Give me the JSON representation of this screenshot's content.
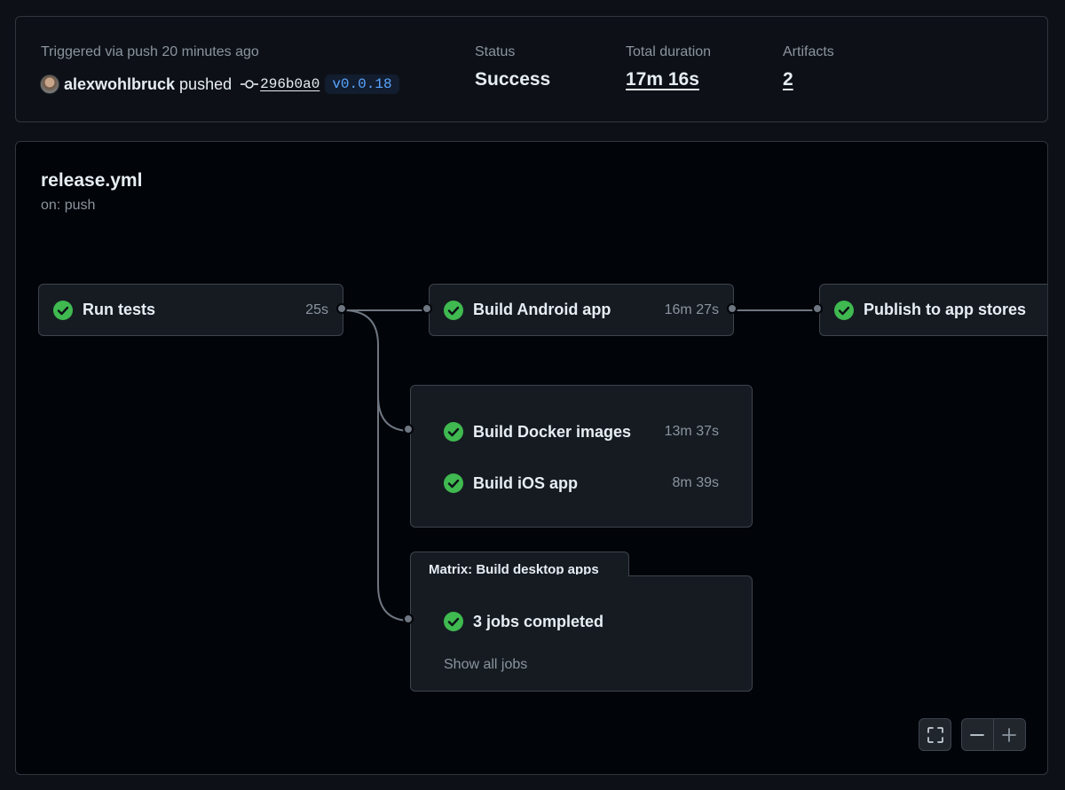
{
  "summary": {
    "trigger_text": "Triggered via push 20 minutes ago",
    "user": "alexwohlbruck",
    "action": "pushed",
    "commit_sha": "296b0a0",
    "tag": "v0.0.18",
    "status_label": "Status",
    "status_value": "Success",
    "duration_label": "Total duration",
    "duration_value": "17m 16s",
    "artifacts_label": "Artifacts",
    "artifacts_value": "2"
  },
  "workflow": {
    "name": "release.yml",
    "trigger": "on: push"
  },
  "jobs": {
    "run_tests": {
      "name": "Run tests",
      "duration": "25s",
      "status": "success"
    },
    "build_android": {
      "name": "Build Android app",
      "duration": "16m 27s",
      "status": "success"
    },
    "publish": {
      "name": "Publish to app stores",
      "duration": "",
      "status": "success"
    },
    "build_docker": {
      "name": "Build Docker images",
      "duration": "13m 37s",
      "status": "success"
    },
    "build_ios": {
      "name": "Build iOS app",
      "duration": "8m 39s",
      "status": "success"
    },
    "matrix": {
      "title": "Matrix: Build desktop apps",
      "summary": "3 jobs completed",
      "show_all": "Show all jobs"
    }
  },
  "colors": {
    "success": "#3fb950",
    "background": "#0d1117",
    "canvas": "#010409",
    "accent_link": "#58a6ff"
  },
  "icons": {
    "commit": "git-commit-icon",
    "check": "check-circle-fill-icon",
    "fullscreen": "screen-full-icon",
    "zoom_out": "dash-icon",
    "zoom_in": "plus-icon"
  }
}
